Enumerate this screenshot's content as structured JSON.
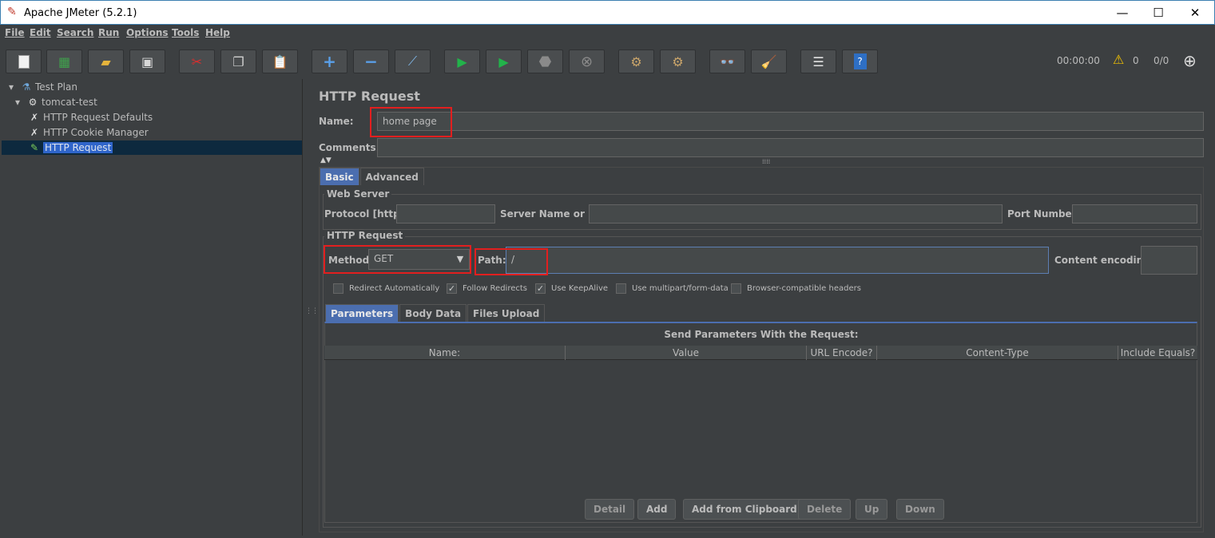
{
  "window": {
    "title": "Apache JMeter (5.2.1)",
    "minimize": "—",
    "maximize": "☐",
    "close": "✕"
  },
  "menu": [
    "File",
    "Edit",
    "Search",
    "Run",
    "Options",
    "Tools",
    "Help"
  ],
  "toolbar": {
    "buttons": [
      "new-icon",
      "templates-icon",
      "open-icon",
      "save-icon",
      "cut-icon",
      "copy-icon",
      "paste-icon",
      "expand-icon",
      "collapse-icon",
      "toggle-icon",
      "start-icon",
      "start-no-pause-icon",
      "stop-icon",
      "shutdown-icon",
      "clear-icon",
      "clear-all-icon",
      "search-icon",
      "reset-search-icon",
      "function-helper-icon",
      "help-icon"
    ],
    "timer": "00:00:00",
    "warnings": "0",
    "threads": "0/0"
  },
  "tree": {
    "nodes": [
      {
        "label": "Test Plan",
        "icon": "flask-icon"
      },
      {
        "label": "tomcat-test",
        "icon": "gear-icon"
      },
      {
        "label": "HTTP Request Defaults",
        "icon": "wrench-icon"
      },
      {
        "label": "HTTP Cookie Manager",
        "icon": "wrench-icon"
      },
      {
        "label": "HTTP Request",
        "icon": "pipette-icon"
      }
    ]
  },
  "form": {
    "title": "HTTP Request",
    "name_label": "Name:",
    "name_value": "home page",
    "comments_label": "Comments:",
    "comments_value": "",
    "tabs": [
      "Basic",
      "Advanced"
    ],
    "web_server": {
      "group": "Web Server",
      "protocol_label": "Protocol [http]:",
      "protocol_value": "",
      "server_label": "Server Name or IP:",
      "server_value": "",
      "port_label": "Port Number:",
      "port_value": ""
    },
    "http_request": {
      "group": "HTTP Request",
      "method_label": "Method:",
      "method_value": "GET",
      "path_label": "Path:",
      "path_value": "/",
      "encoding_label": "Content encoding:",
      "encoding_value": ""
    },
    "options": [
      {
        "label": "Redirect Automatically",
        "checked": false
      },
      {
        "label": "Follow Redirects",
        "checked": true
      },
      {
        "label": "Use KeepAlive",
        "checked": true
      },
      {
        "label": "Use multipart/form-data",
        "checked": false
      },
      {
        "label": "Browser-compatible headers",
        "checked": false
      }
    ],
    "param_tabs": [
      "Parameters",
      "Body Data",
      "Files Upload"
    ],
    "params_caption": "Send Parameters With the Request:",
    "columns": [
      "Name:",
      "Value",
      "URL Encode?",
      "Content-Type",
      "Include Equals?"
    ],
    "buttons": [
      "Detail",
      "Add",
      "Add from Clipboard",
      "Delete",
      "Up",
      "Down"
    ]
  }
}
